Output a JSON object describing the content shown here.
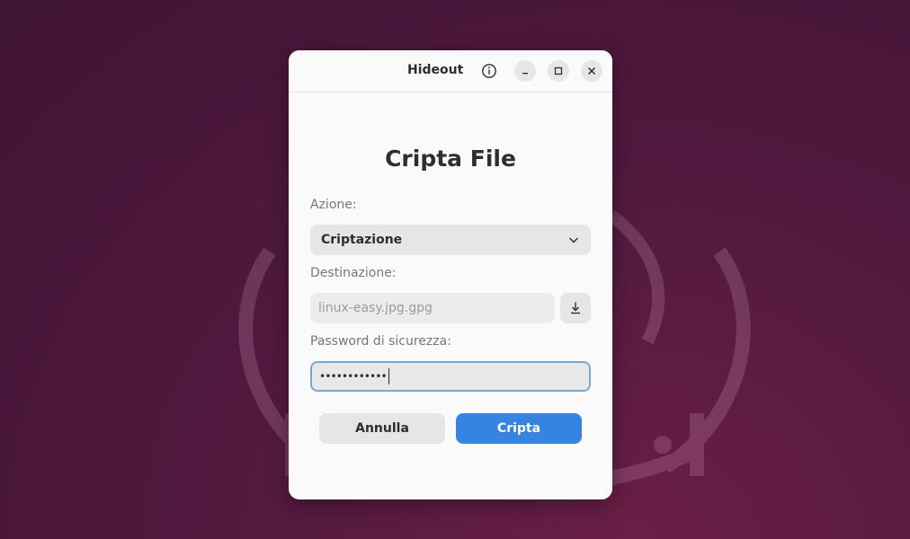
{
  "window": {
    "title": "Hideout",
    "icons": {
      "info": "info-icon",
      "minimize": "minimize-icon",
      "maximize": "maximize-icon",
      "close": "close-icon"
    }
  },
  "page": {
    "title": "Cripta File"
  },
  "form": {
    "action_label": "Azione:",
    "action_value": "Criptazione",
    "action_icon": "chevron-down-icon",
    "destination_label": "Destinazione:",
    "destination_placeholder": "linux-easy.jpg.gpg",
    "destination_button_icon": "save-download-icon",
    "password_label": "Password di sicurezza:",
    "password_value": "••••••••••••"
  },
  "buttons": {
    "cancel": "Annulla",
    "encrypt": "Cripta"
  },
  "colors": {
    "accent": "#3584e4",
    "focus_border": "#7aa6d6",
    "desktop_bg": "#52193f"
  }
}
